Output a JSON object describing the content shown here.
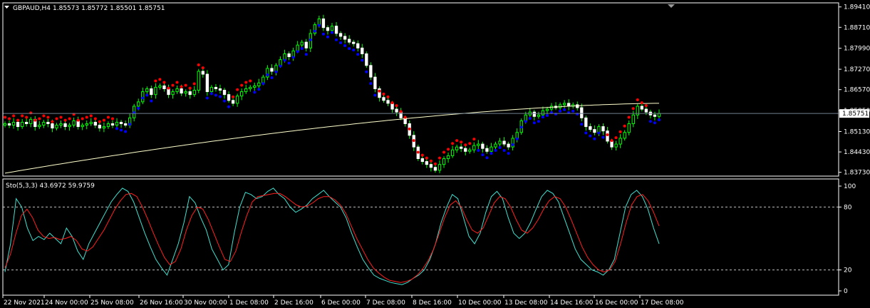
{
  "header": {
    "symbol": "GBPAUD,H4",
    "ohlc": "1.85573 1.85772 1.85501 1.85751",
    "indicator": "Sto(5,3,3) 43.6972 59.9759"
  },
  "colors": {
    "background": "#000000",
    "bull_candle": "#00ff00",
    "bear_candle": "#ffffff",
    "psar_up": "#0000ff",
    "psar_down": "#ff0000",
    "ma_line": "#ffffcc",
    "stoch_main": "#40e0d0",
    "stoch_signal": "#ff2020",
    "axis": "#ffffff",
    "price_label_bg": "#ffffff"
  },
  "chart_data": [
    {
      "type": "candlestick",
      "y_ticks": [
        "1.89410",
        "1.88710",
        "1.87990",
        "1.87270",
        "1.86570",
        "1.85850",
        "1.85130",
        "1.84430",
        "1.83730"
      ],
      "ylim": [
        1.836,
        1.8955
      ],
      "current_price": "1.85751",
      "x_tick_labels": [
        "22 Nov 2021",
        "24 Nov 00:00",
        "25 Nov 08:00",
        "26 Nov 16:00",
        "30 Nov 00:00",
        "1 Dec 08:00",
        "2 Dec 16:00",
        "6 Dec 00:00",
        "7 Dec 08:00",
        "8 Dec 16:00",
        "10 Dec 00:00",
        "13 Dec 08:00",
        "14 Dec 16:00",
        "16 Dec 00:00",
        "17 Dec 08:00"
      ],
      "closes": [
        1.854,
        1.8535,
        1.8545,
        1.853,
        1.8545,
        1.854,
        1.8555,
        1.853,
        1.8535,
        1.8545,
        1.854,
        1.8525,
        1.8535,
        1.854,
        1.853,
        1.8535,
        1.855,
        1.853,
        1.8535,
        1.854,
        1.8545,
        1.8535,
        1.8525,
        1.853,
        1.854,
        1.8535,
        1.8545,
        1.854,
        1.8535,
        1.856,
        1.86,
        1.8615,
        1.865,
        1.866,
        1.864,
        1.8665,
        1.867,
        1.866,
        1.864,
        1.865,
        1.866,
        1.8645,
        1.865,
        1.864,
        1.8655,
        1.872,
        1.871,
        1.865,
        1.8665,
        1.866,
        1.8655,
        1.864,
        1.862,
        1.861,
        1.8635,
        1.865,
        1.866,
        1.8665,
        1.867,
        1.868,
        1.87,
        1.873,
        1.872,
        1.874,
        1.876,
        1.878,
        1.877,
        1.879,
        1.881,
        1.882,
        1.88,
        1.885,
        1.888,
        1.89,
        1.887,
        1.886,
        1.8875,
        1.885,
        1.884,
        1.883,
        1.882,
        1.8815,
        1.88,
        1.878,
        1.874,
        1.87,
        1.866,
        1.863,
        1.862,
        1.861,
        1.859,
        1.858,
        1.856,
        1.854,
        1.85,
        1.846,
        1.842,
        1.841,
        1.84,
        1.839,
        1.838,
        1.84,
        1.842,
        1.843,
        1.845,
        1.846,
        1.8455,
        1.8445,
        1.845,
        1.8465,
        1.847,
        1.8455,
        1.8445,
        1.846,
        1.847,
        1.848,
        1.847,
        1.846,
        1.849,
        1.851,
        1.855,
        1.857,
        1.858,
        1.8565,
        1.857,
        1.8585,
        1.859,
        1.86,
        1.8595,
        1.8605,
        1.861,
        1.86,
        1.8605,
        1.8595,
        1.856,
        1.853,
        1.852,
        1.851,
        1.853,
        1.8515,
        1.848,
        1.846,
        1.847,
        1.849,
        1.851,
        1.854,
        1.857,
        1.86,
        1.859,
        1.858,
        1.857,
        1.8565,
        1.8575
      ],
      "ma": {
        "start": 1.837,
        "end": 1.861
      },
      "psar_switches": [
        [
          0,
          "down"
        ],
        [
          26,
          "up"
        ],
        [
          35,
          "down"
        ],
        [
          47,
          "up"
        ],
        [
          53,
          "down"
        ],
        [
          58,
          "up"
        ],
        [
          87,
          "down"
        ],
        [
          110,
          "up"
        ],
        [
          140,
          "down"
        ],
        [
          150,
          "up"
        ]
      ]
    },
    {
      "type": "line",
      "title": "Sto(5,3,3) 43.6972 59.9759",
      "y_ticks": [
        "100",
        "80",
        "20",
        "0"
      ],
      "ylim": [
        0,
        100
      ],
      "levels": [
        80,
        20
      ],
      "series": [
        {
          "values": [
            18,
            45,
            88,
            80,
            60,
            48,
            52,
            49,
            55,
            50,
            45,
            60,
            52,
            38,
            30,
            45,
            55,
            65,
            75,
            85,
            92,
            98,
            95,
            85,
            70,
            55,
            42,
            30,
            22,
            15,
            30,
            45,
            65,
            90,
            84,
            70,
            58,
            40,
            30,
            20,
            25,
            55,
            80,
            94,
            92,
            88,
            90,
            95,
            98,
            92,
            88,
            80,
            75,
            78,
            82,
            88,
            92,
            96,
            90,
            85,
            80,
            70,
            55,
            42,
            30,
            22,
            15,
            12,
            10,
            8,
            7,
            6,
            8,
            12,
            15,
            20,
            30,
            45,
            65,
            80,
            92,
            88,
            70,
            52,
            45,
            55,
            75,
            90,
            95,
            88,
            70,
            55,
            50,
            55,
            65,
            78,
            90,
            96,
            93,
            85,
            70,
            55,
            40,
            30,
            25,
            20,
            18,
            15,
            20,
            30,
            55,
            80,
            92,
            96,
            90,
            78,
            60,
            45
          ]
        },
        {
          "values": [
            22,
            35,
            55,
            72,
            78,
            70,
            58,
            52,
            50,
            51,
            49,
            50,
            52,
            48,
            40,
            38,
            42,
            50,
            58,
            68,
            78,
            86,
            92,
            93,
            90,
            80,
            68,
            55,
            43,
            32,
            25,
            28,
            40,
            58,
            72,
            80,
            78,
            68,
            55,
            42,
            30,
            28,
            38,
            56,
            72,
            85,
            90,
            91,
            92,
            93,
            93,
            90,
            86,
            82,
            80,
            81,
            84,
            88,
            90,
            90,
            87,
            82,
            74,
            62,
            50,
            40,
            30,
            22,
            17,
            13,
            10,
            9,
            8,
            9,
            11,
            15,
            21,
            29,
            40,
            55,
            70,
            82,
            86,
            80,
            68,
            58,
            55,
            60,
            72,
            84,
            90,
            88,
            80,
            68,
            58,
            55,
            60,
            68,
            78,
            86,
            90,
            88,
            80,
            68,
            55,
            42,
            32,
            25,
            20,
            18,
            20,
            28,
            45,
            65,
            82,
            90,
            92,
            86,
            75,
            62
          ]
        }
      ]
    }
  ]
}
